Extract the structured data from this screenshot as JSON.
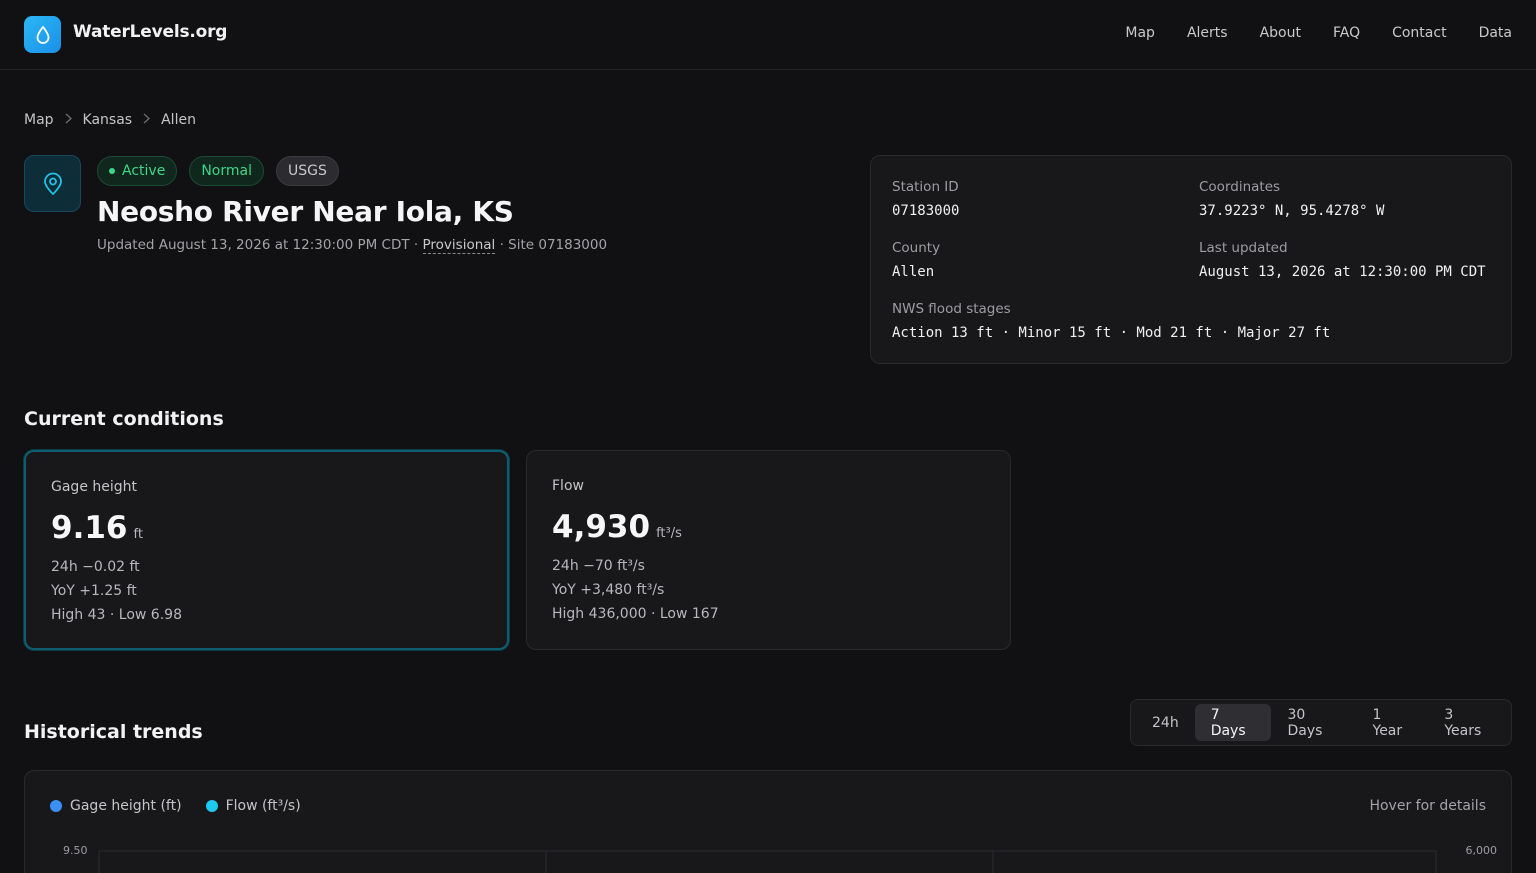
{
  "header": {
    "brand": "WaterLevels.org",
    "nav": [
      "Map",
      "Alerts",
      "About",
      "FAQ",
      "Contact",
      "Data"
    ]
  },
  "breadcrumb": [
    "Map",
    "Kansas",
    "Allen"
  ],
  "station": {
    "badges": {
      "active": "Active",
      "normal": "Normal",
      "source": "USGS"
    },
    "title": "Neosho River Near Iola, KS",
    "updated_prefix": "Updated August 13, 2026 at 12:30:00 PM CDT · ",
    "provisional": "Provisional",
    "site_suffix": " · Site 07183000"
  },
  "info": {
    "station_id_label": "Station ID",
    "station_id": "07183000",
    "coordinates_label": "Coordinates",
    "coordinates": "37.9223° N, 95.4278° W",
    "county_label": "County",
    "county": "Allen",
    "last_updated_label": "Last updated",
    "last_updated": "August 13, 2026 at 12:30:00 PM CDT",
    "flood_label": "NWS flood stages",
    "flood_stages": "Action 13 ft · Minor 15 ft · Mod 21 ft · Major 27 ft"
  },
  "conditions": {
    "title": "Current conditions",
    "gage": {
      "label": "Gage height",
      "value": "9.16",
      "unit": "ft",
      "change_24h": "24h −0.02 ft",
      "yoy": "YoY +1.25 ft",
      "range": "High 43 · Low 6.98"
    },
    "flow": {
      "label": "Flow",
      "value": "4,930",
      "unit": "ft³/s",
      "change_24h": "24h −70 ft³/s",
      "yoy": "YoY +3,480 ft³/s",
      "range": "High 436,000 · Low 167"
    }
  },
  "trends": {
    "title": "Historical trends",
    "ranges": [
      "24h",
      "7 Days",
      "30 Days",
      "1 Year",
      "3 Years"
    ],
    "selected_range": "7 Days",
    "legend": {
      "gage": "Gage height (ft)",
      "flow": "Flow (ft³/s)"
    },
    "hover_note": "Hover for details",
    "y_left_top": "9.50",
    "y_right_top": "6,000"
  },
  "colors": {
    "accent": "#2bb8f5",
    "gage_series": "#3b8ff5",
    "flow_series": "#1ec9ef",
    "status_green": "#3ed68a"
  }
}
